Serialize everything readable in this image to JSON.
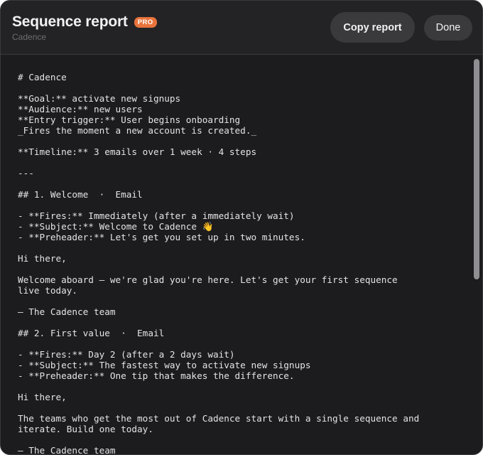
{
  "header": {
    "title": "Sequence report",
    "badge": "PRO",
    "subtitle": "Cadence",
    "copy_label": "Copy report",
    "done_label": "Done"
  },
  "report": {
    "lines": [
      "# Cadence",
      "",
      "**Goal:** activate new signups",
      "**Audience:** new users",
      "**Entry trigger:** User begins onboarding",
      "_Fires the moment a new account is created._",
      "",
      "**Timeline:** 3 emails over 1 week · 4 steps",
      "",
      "---",
      "",
      "## 1. Welcome  ·  Email",
      "",
      "- **Fires:** Immediately (after a immediately wait)",
      "- **Subject:** Welcome to Cadence 👋",
      "- **Preheader:** Let's get you set up in two minutes.",
      "",
      "Hi there,",
      "",
      "Welcome aboard — we're glad you're here. Let's get your first sequence",
      "live today.",
      "",
      "— The Cadence team",
      "",
      "## 2. First value  ·  Email",
      "",
      "- **Fires:** Day 2 (after a 2 days wait)",
      "- **Subject:** The fastest way to activate new signups",
      "- **Preheader:** One tip that makes the difference.",
      "",
      "Hi there,",
      "",
      "The teams who get the most out of Cadence start with a single sequence and",
      "iterate. Build one today.",
      "",
      "— The Cadence team"
    ]
  }
}
